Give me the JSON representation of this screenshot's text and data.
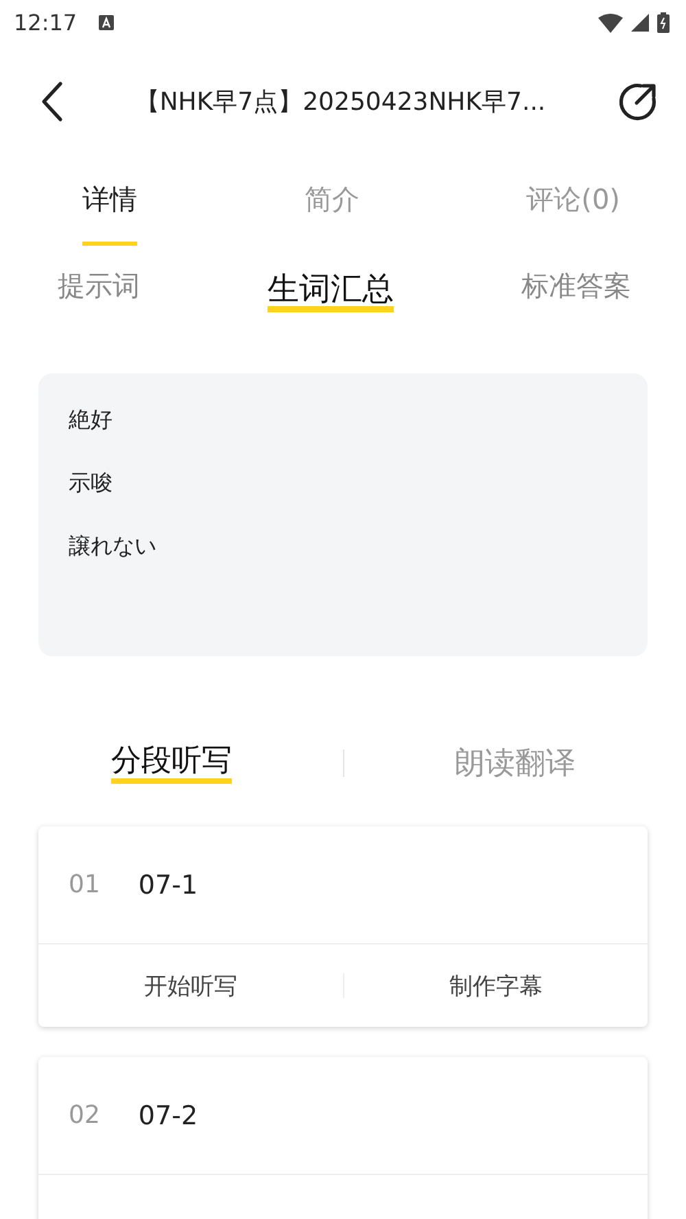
{
  "status_bar": {
    "time": "12:17"
  },
  "header": {
    "title": "【NHK早7点】20250423NHK早7..."
  },
  "tabs": [
    {
      "label": "详情",
      "selected": true
    },
    {
      "label": "简介",
      "selected": false
    },
    {
      "label": "评论(0)",
      "selected": false
    }
  ],
  "sub_tabs": [
    {
      "label": "提示词",
      "selected": false
    },
    {
      "label": "生词汇总",
      "selected": true
    },
    {
      "label": "标准答案",
      "selected": false
    }
  ],
  "vocabulary": [
    "絶好",
    "示唆",
    "譲れない"
  ],
  "mode_tabs": [
    {
      "label": "分段听写",
      "selected": true
    },
    {
      "label": "朗读翻译",
      "selected": false
    }
  ],
  "segments": [
    {
      "number": "01",
      "title": "07-1",
      "actions": [
        "开始听写",
        "制作字幕"
      ]
    },
    {
      "number": "02",
      "title": "07-2"
    }
  ]
}
